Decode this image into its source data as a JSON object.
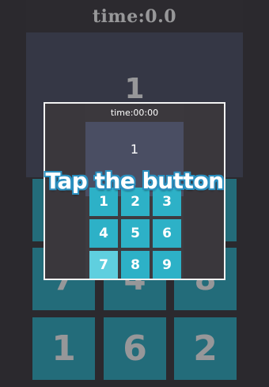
{
  "game": {
    "timer_text": "time:0.0",
    "target_number": "1",
    "grid": [
      {
        "label": ""
      },
      {
        "label": ""
      },
      {
        "label": ""
      },
      {
        "label": "7"
      },
      {
        "label": "4"
      },
      {
        "label": "8"
      },
      {
        "label": "1"
      },
      {
        "label": "6"
      },
      {
        "label": "2"
      }
    ]
  },
  "tutorial": {
    "banner_text": "Tap the button",
    "preview": {
      "timer_text": "time:00:00",
      "target_number": "1",
      "keys": [
        {
          "label": "1",
          "highlighted": false
        },
        {
          "label": "2",
          "highlighted": false
        },
        {
          "label": "3",
          "highlighted": false
        },
        {
          "label": "4",
          "highlighted": false
        },
        {
          "label": "5",
          "highlighted": false
        },
        {
          "label": "6",
          "highlighted": false
        },
        {
          "label": "7",
          "highlighted": true
        },
        {
          "label": "8",
          "highlighted": false
        },
        {
          "label": "9",
          "highlighted": false
        }
      ]
    }
  },
  "colors": {
    "background": "#3b383c",
    "display": "#4d5167",
    "tile": "#2db1c7",
    "tile_highlight": "#5fcfdf",
    "banner_outline": "#2a8fbf"
  }
}
